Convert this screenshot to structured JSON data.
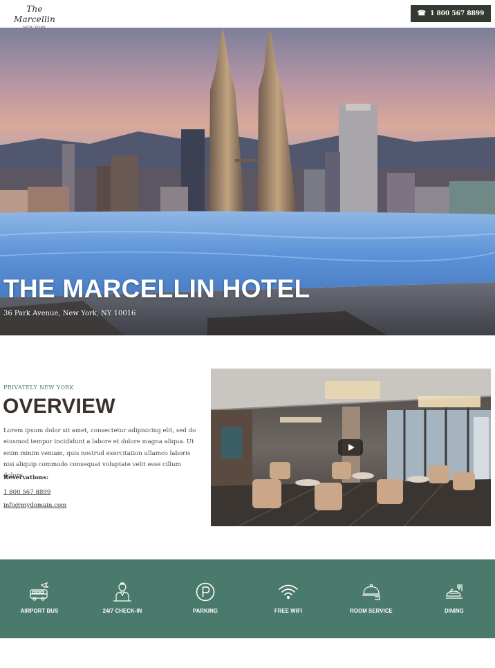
{
  "header": {
    "logo_script": "The Marcellin",
    "logo_city": "NEW YORK",
    "phone_icon": "telephone-icon",
    "phone_label": "1 800 567 8899"
  },
  "hero": {
    "title": "THE MARCELLIN HOTEL",
    "address": "36 Park Avenue, New York, NY 10016"
  },
  "overview": {
    "eyebrow": "PRIVATELY NEW YORK",
    "title": "OVERVIEW",
    "body": "Lorem ipsum dolor sit amet, consectetur adipisicing elit, sed do eiusmod tempor incididunt a labore et dolore magna aliqua. Ut enim minim veniam, quis nostrud exercitation ullamco laboris nisi aliquip commodo consequat voluptate velit esse cillum dolore.",
    "reservations_label": "Reservations:",
    "phone": "1 800 567 8899",
    "email": "info@mydomain.com",
    "video_icon": "play-icon"
  },
  "amenities": {
    "background": "#4a7a6c",
    "items": [
      {
        "label": "AIRPORT BUS",
        "icon": "bus-icon"
      },
      {
        "label": "24/7 CHECK-IN",
        "icon": "concierge-icon"
      },
      {
        "label": "PARKING",
        "icon": "parking-icon"
      },
      {
        "label": "FREE WIFI",
        "icon": "wifi-icon"
      },
      {
        "label": "ROOM SERVICE",
        "icon": "cloche-icon"
      },
      {
        "label": "DINING",
        "icon": "dining-icon"
      }
    ]
  },
  "colors": {
    "phone_button": "#333a2f",
    "eyebrow": "#4a7a6b",
    "title": "#3b302a"
  }
}
